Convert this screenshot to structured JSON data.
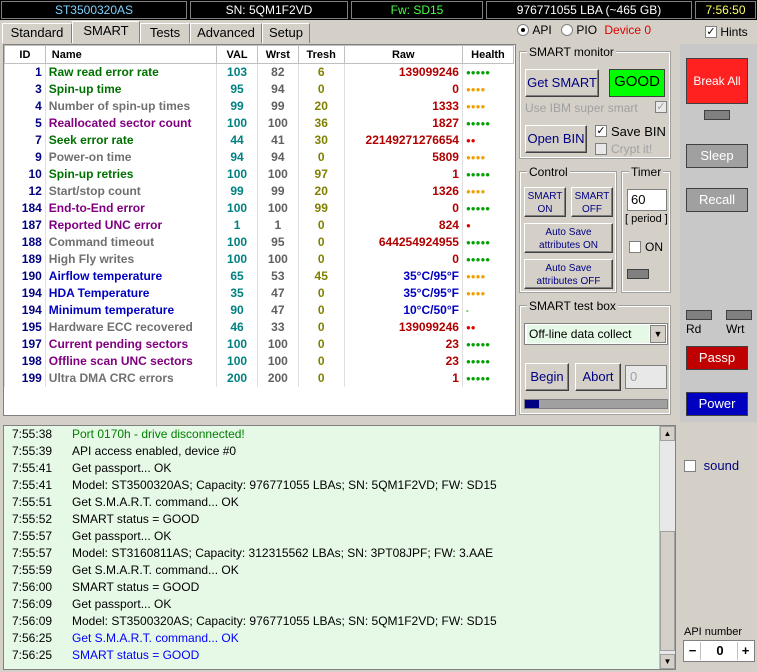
{
  "topbar": {
    "model": "ST3500320AS",
    "sn": "SN: 5QM1F2VD",
    "fw": "Fw: SD15",
    "lba": "976771055 LBA (~465 GB)",
    "time": "7:56:50"
  },
  "tabs": [
    "Standard",
    "SMART",
    "Tests",
    "Advanced",
    "Setup"
  ],
  "api_bar": {
    "api": "API",
    "pio": "PIO",
    "device": "Device 0",
    "hints": "Hints"
  },
  "table": {
    "headers": [
      "ID",
      "Name",
      "VAL",
      "Wrst",
      "Tresh",
      "Raw",
      "Health"
    ],
    "rows": [
      {
        "id": "1",
        "name": "Raw read error rate",
        "val": "103",
        "wrst": "82",
        "tresh": "6",
        "raw": "139099246",
        "health": "●●●●●",
        "name_color": "green",
        "health_color": "green"
      },
      {
        "id": "3",
        "name": "Spin-up time",
        "val": "95",
        "wrst": "94",
        "tresh": "0",
        "raw": "0",
        "health": "●●●●",
        "name_color": "green",
        "health_color": "yellow"
      },
      {
        "id": "4",
        "name": "Number of spin-up times",
        "val": "99",
        "wrst": "99",
        "tresh": "20",
        "raw": "1333",
        "health": "●●●●",
        "name_color": "gray",
        "health_color": "yellow"
      },
      {
        "id": "5",
        "name": "Reallocated sector count",
        "val": "100",
        "wrst": "100",
        "tresh": "36",
        "raw": "1827",
        "health": "●●●●●",
        "name_color": "purple",
        "health_color": "green"
      },
      {
        "id": "7",
        "name": "Seek error rate",
        "val": "44",
        "wrst": "41",
        "tresh": "30",
        "raw": "22149271276654",
        "health": "●●",
        "name_color": "green",
        "health_color": "red"
      },
      {
        "id": "9",
        "name": "Power-on time",
        "val": "94",
        "wrst": "94",
        "tresh": "0",
        "raw": "5809",
        "health": "●●●●",
        "name_color": "gray",
        "health_color": "yellow"
      },
      {
        "id": "10",
        "name": "Spin-up retries",
        "val": "100",
        "wrst": "100",
        "tresh": "97",
        "raw": "1",
        "health": "●●●●●",
        "name_color": "green",
        "health_color": "green"
      },
      {
        "id": "12",
        "name": "Start/stop count",
        "val": "99",
        "wrst": "99",
        "tresh": "20",
        "raw": "1326",
        "health": "●●●●",
        "name_color": "gray",
        "health_color": "yellow"
      },
      {
        "id": "184",
        "name": "End-to-End error",
        "val": "100",
        "wrst": "100",
        "tresh": "99",
        "raw": "0",
        "health": "●●●●●",
        "name_color": "purple",
        "health_color": "green"
      },
      {
        "id": "187",
        "name": "Reported UNC error",
        "val": "1",
        "wrst": "1",
        "tresh": "0",
        "raw": "824",
        "health": "●",
        "name_color": "purple",
        "health_color": "red"
      },
      {
        "id": "188",
        "name": "Command timeout",
        "val": "100",
        "wrst": "95",
        "tresh": "0",
        "raw": "644254924955",
        "health": "●●●●●",
        "name_color": "gray",
        "health_color": "green"
      },
      {
        "id": "189",
        "name": "High Fly writes",
        "val": "100",
        "wrst": "100",
        "tresh": "0",
        "raw": "0",
        "health": "●●●●●",
        "name_color": "gray",
        "health_color": "green"
      },
      {
        "id": "190",
        "name": "Airflow temperature",
        "val": "65",
        "wrst": "53",
        "tresh": "45",
        "raw": "35°C/95°F",
        "health": "●●●●",
        "name_color": "blue",
        "health_color": "yellow",
        "raw_blue": true
      },
      {
        "id": "194",
        "name": "HDA Temperature",
        "val": "35",
        "wrst": "47",
        "tresh": "0",
        "raw": "35°C/95°F",
        "health": "●●●●",
        "name_color": "blue",
        "health_color": "yellow",
        "raw_blue": true
      },
      {
        "id": "194",
        "name": "Minimum temperature",
        "val": "90",
        "wrst": "47",
        "tresh": "0",
        "raw": "10°C/50°F",
        "health": "-",
        "name_color": "blue",
        "health_color": "green",
        "raw_blue": true
      },
      {
        "id": "195",
        "name": "Hardware ECC recovered",
        "val": "46",
        "wrst": "33",
        "tresh": "0",
        "raw": "139099246",
        "health": "●●",
        "name_color": "gray",
        "health_color": "red"
      },
      {
        "id": "197",
        "name": "Current pending sectors",
        "val": "100",
        "wrst": "100",
        "tresh": "0",
        "raw": "23",
        "health": "●●●●●",
        "name_color": "purple",
        "health_color": "green"
      },
      {
        "id": "198",
        "name": "Offline scan UNC sectors",
        "val": "100",
        "wrst": "100",
        "tresh": "0",
        "raw": "23",
        "health": "●●●●●",
        "name_color": "purple",
        "health_color": "green"
      },
      {
        "id": "199",
        "name": "Ultra DMA CRC errors",
        "val": "200",
        "wrst": "200",
        "tresh": "0",
        "raw": "1",
        "health": "●●●●●",
        "name_color": "gray",
        "health_color": "green"
      }
    ]
  },
  "smart_monitor": {
    "title": "SMART monitor",
    "get_smart": "Get SMART",
    "status": "GOOD",
    "ibm": "Use IBM super smart",
    "open_bin": "Open BIN",
    "save_bin": "Save BIN",
    "crypt": "Crypt it!"
  },
  "control": {
    "title": "Control",
    "smart_on": "SMART ON",
    "smart_off": "SMART OFF",
    "autosave_on": "Auto Save attributes ON",
    "autosave_off": "Auto Save attributes OFF"
  },
  "timer": {
    "title": "Timer",
    "value": "60",
    "period": "[ period ]",
    "on": "ON"
  },
  "test_box": {
    "title": "SMART test box",
    "selected": "Off-line data collect",
    "begin": "Begin",
    "abort": "Abort",
    "counter": "0"
  },
  "right_panel": {
    "break_all": "Break All",
    "sleep": "Sleep",
    "recall": "Recall",
    "rd": "Rd",
    "wrt": "Wrt",
    "passp": "Passp",
    "power": "Power",
    "sound": "sound",
    "api_number_label": "API number",
    "api_number": "0",
    "minus": "−",
    "plus": "+"
  },
  "log": [
    {
      "time": "7:55:38",
      "msg": "Port 0170h - drive disconnected!",
      "color": "green"
    },
    {
      "time": "7:55:39",
      "msg": "API access enabled, device #0",
      "color": "black"
    },
    {
      "time": "7:55:41",
      "msg": "Get passport... OK",
      "color": "black"
    },
    {
      "time": "7:55:41",
      "msg": "Model: ST3500320AS; Capacity: 976771055 LBAs; SN: 5QM1F2VD; FW: SD15",
      "color": "black"
    },
    {
      "time": "7:55:51",
      "msg": "Get S.M.A.R.T. command... OK",
      "color": "black"
    },
    {
      "time": "7:55:52",
      "msg": "SMART status = GOOD",
      "color": "black"
    },
    {
      "time": "7:55:57",
      "msg": "Get passport... OK",
      "color": "black"
    },
    {
      "time": "7:55:57",
      "msg": "Model: ST3160811AS; Capacity: 312315562 LBAs; SN: 3PT08JPF; FW: 3.AAE",
      "color": "black"
    },
    {
      "time": "7:55:59",
      "msg": "Get S.M.A.R.T. command... OK",
      "color": "black"
    },
    {
      "time": "7:56:00",
      "msg": "SMART status = GOOD",
      "color": "black"
    },
    {
      "time": "7:56:09",
      "msg": "Get passport... OK",
      "color": "black"
    },
    {
      "time": "7:56:09",
      "msg": "Model: ST3500320AS; Capacity: 976771055 LBAs; SN: 5QM1F2VD; FW: SD15",
      "color": "black"
    },
    {
      "time": "7:56:25",
      "msg": "Get S.M.A.R.T. command... OK",
      "color": "blue"
    },
    {
      "time": "7:56:25",
      "msg": "SMART status = GOOD",
      "color": "blue"
    }
  ]
}
